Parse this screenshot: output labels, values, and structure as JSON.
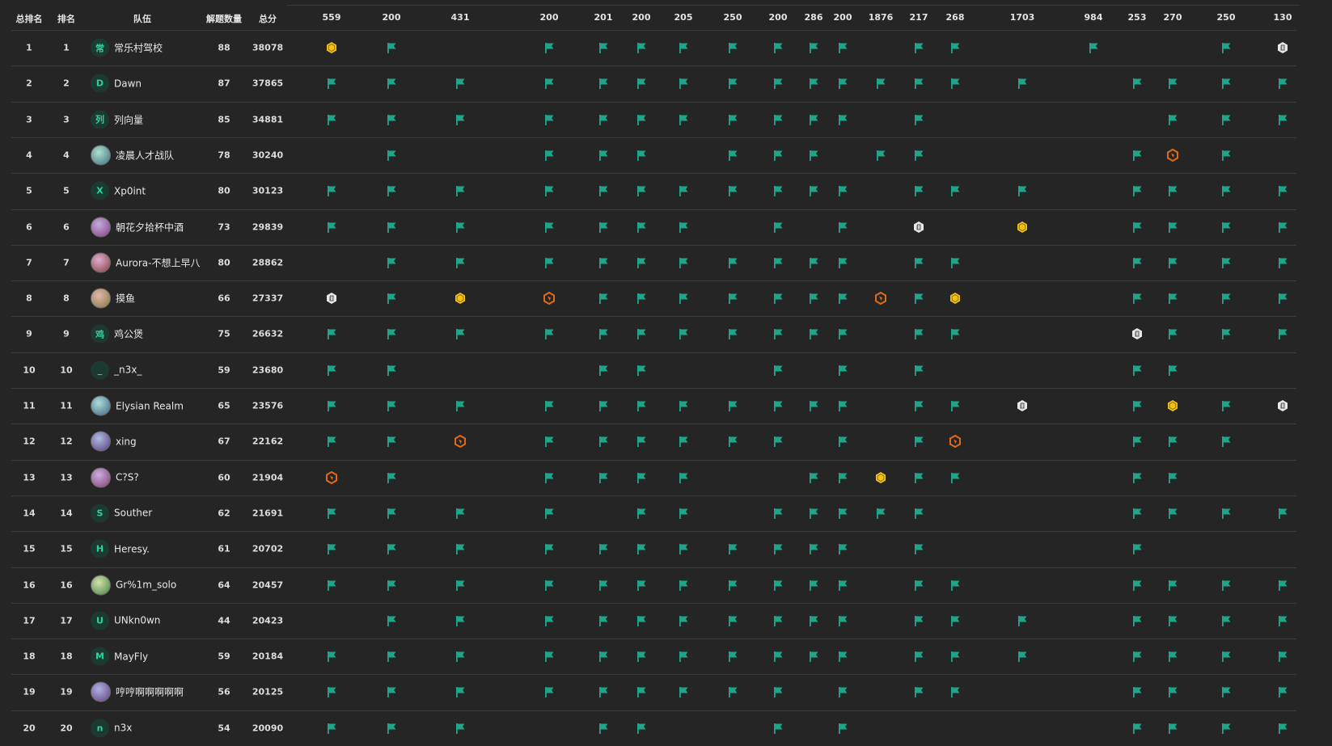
{
  "header": {
    "overall_rank_label": "总排名",
    "rank_label": "排名",
    "team_label": "队伍",
    "solved_label": "解题数量",
    "score_label": "总分"
  },
  "challenge_scores": [
    "559",
    "200",
    "431",
    "200",
    "201",
    "200",
    "205",
    "250",
    "200",
    "286",
    "200",
    "1876",
    "217",
    "268",
    "1703",
    "984",
    "253",
    "270",
    "250",
    "130"
  ],
  "colors": {
    "background": "#252525",
    "flag": "#1fa58a",
    "gold": "#f2c21b",
    "bronze": "#e06a17",
    "silver": "#e8e8e8",
    "avatar_letter": "#2ad39b"
  },
  "legend": {
    "F": "solved-flag-icon",
    "G": "first-blood-gold-icon",
    "S": "second-blood-silver-icon",
    "B": "third-blood-bronze-icon",
    "-": "unsolved"
  },
  "rows": [
    {
      "overall": "1",
      "rank": "1",
      "avatar": "常",
      "avatar_type": "letter",
      "avatar_icon": "",
      "name": "常乐村驾校",
      "solved": "88",
      "score": "38078",
      "marks": "GF-FFFFFFFF-FF-F--FSF"
    },
    {
      "overall": "2",
      "rank": "2",
      "avatar": "D",
      "avatar_type": "letter",
      "avatar_icon": "",
      "name": "Dawn",
      "solved": "87",
      "score": "37865",
      "marks": "FFFFFFFFFFFFFFF-FFFF"
    },
    {
      "overall": "3",
      "rank": "3",
      "avatar": "列",
      "avatar_type": "letter",
      "avatar_icon": "",
      "name": "列向量",
      "solved": "85",
      "score": "34881",
      "marks": "FFFFFFFFFFF-F----FFFF"
    },
    {
      "overall": "4",
      "rank": "4",
      "avatar": "",
      "avatar_type": "pic",
      "avatar_icon": "avatar-image-icon",
      "name": "凌晨人才战队",
      "solved": "78",
      "score": "30240",
      "marks": "-F-FFF-FFF-FF---FBF-"
    },
    {
      "overall": "5",
      "rank": "5",
      "avatar": "X",
      "avatar_type": "letter",
      "avatar_icon": "",
      "name": "Xp0int",
      "solved": "80",
      "score": "30123",
      "marks": "FFFFFFFFFFF-FFF-FFFF"
    },
    {
      "overall": "6",
      "rank": "6",
      "avatar": "",
      "avatar_type": "pic",
      "avatar_icon": "avatar-image-icon",
      "name": "朝花夕拾杯中酒",
      "solved": "73",
      "score": "29839",
      "marks": "FFFFFFF-F-F-S-G-FFFF"
    },
    {
      "overall": "7",
      "rank": "7",
      "avatar": "",
      "avatar_type": "pic",
      "avatar_icon": "avatar-image-icon",
      "name": "Aurora-不想上早八",
      "solved": "80",
      "score": "28862",
      "marks": "-FFFFFFFFFF-FF--FFFF"
    },
    {
      "overall": "8",
      "rank": "8",
      "avatar": "",
      "avatar_type": "pic",
      "avatar_icon": "avatar-image-icon",
      "name": "摸鱼",
      "solved": "66",
      "score": "27337",
      "marks": "SFGBFFFFFFFBFG--FFFF"
    },
    {
      "overall": "9",
      "rank": "9",
      "avatar": "鸡",
      "avatar_type": "letter",
      "avatar_icon": "",
      "name": "鸡公煲",
      "solved": "75",
      "score": "26632",
      "marks": "FFFFFFFFFFF-FF--SFFF"
    },
    {
      "overall": "10",
      "rank": "10",
      "avatar": "_",
      "avatar_type": "letter",
      "avatar_icon": "",
      "name": "_n3x_",
      "solved": "59",
      "score": "23680",
      "marks": "FF--FF--F-F-F---FF--"
    },
    {
      "overall": "11",
      "rank": "11",
      "avatar": "",
      "avatar_type": "pic",
      "avatar_icon": "avatar-image-icon",
      "name": "Elysian Realm",
      "solved": "65",
      "score": "23576",
      "marks": "FFFFFFFFFFF-FFS-FGFS"
    },
    {
      "overall": "12",
      "rank": "12",
      "avatar": "",
      "avatar_type": "pic",
      "avatar_icon": "avatar-image-icon",
      "name": "xing",
      "solved": "67",
      "score": "22162",
      "marks": "FFBFFFFFF-F-FB--FFF-"
    },
    {
      "overall": "13",
      "rank": "13",
      "avatar": "",
      "avatar_type": "pic",
      "avatar_icon": "avatar-image-icon",
      "name": "C?S?",
      "solved": "60",
      "score": "21904",
      "marks": "BF-FFFF--FFGFF--FF--"
    },
    {
      "overall": "14",
      "rank": "14",
      "avatar": "S",
      "avatar_type": "letter",
      "avatar_icon": "",
      "name": "Souther",
      "solved": "62",
      "score": "21691",
      "marks": "FFFF-FF-FFFFF---FFFF"
    },
    {
      "overall": "15",
      "rank": "15",
      "avatar": "H",
      "avatar_type": "letter",
      "avatar_icon": "",
      "name": "Heresy.",
      "solved": "61",
      "score": "20702",
      "marks": "FFFFFFFFFFF-F---F---"
    },
    {
      "overall": "16",
      "rank": "16",
      "avatar": "",
      "avatar_type": "pic",
      "avatar_icon": "avatar-image-icon",
      "name": "Gr%1m_solo",
      "solved": "64",
      "score": "20457",
      "marks": "FFFFFFFFFFF-FF--FFFF"
    },
    {
      "overall": "17",
      "rank": "17",
      "avatar": "U",
      "avatar_type": "letter",
      "avatar_icon": "",
      "name": "UNkn0wn",
      "solved": "44",
      "score": "20423",
      "marks": "-FFFFFFFFFF-FFF-FFFF"
    },
    {
      "overall": "18",
      "rank": "18",
      "avatar": "M",
      "avatar_type": "letter",
      "avatar_icon": "",
      "name": "MayFly",
      "solved": "59",
      "score": "20184",
      "marks": "FFFFFFFFFFF-FFF-FFFF"
    },
    {
      "overall": "19",
      "rank": "19",
      "avatar": "",
      "avatar_type": "pic",
      "avatar_icon": "avatar-image-icon",
      "name": "哼哼啊啊啊啊啊",
      "solved": "56",
      "score": "20125",
      "marks": "FFFFFFFFF-F-FF--FFFF"
    },
    {
      "overall": "20",
      "rank": "20",
      "avatar": "n",
      "avatar_type": "letter",
      "avatar_icon": "",
      "name": "n3x",
      "solved": "54",
      "score": "20090",
      "marks": "FFF-FF--F-F-----FFFF"
    }
  ]
}
